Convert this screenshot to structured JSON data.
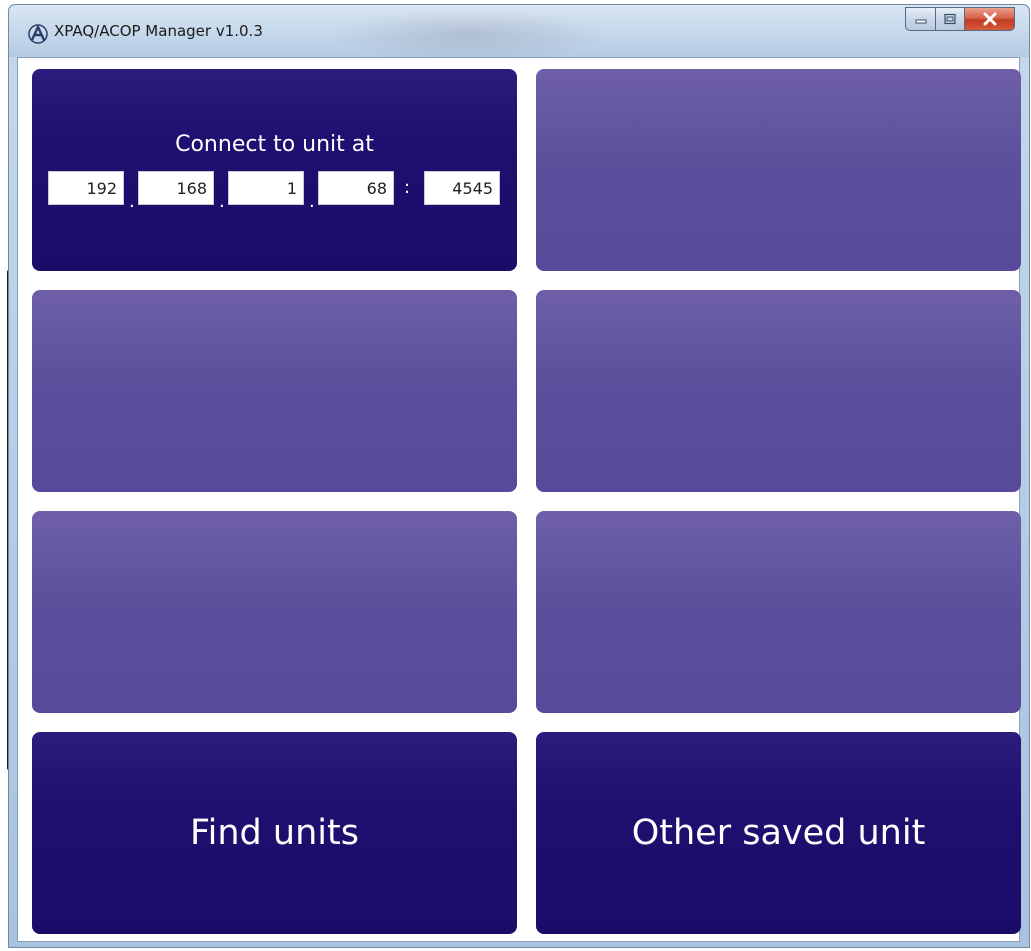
{
  "window": {
    "title": "XPAQ/ACOP Manager v1.0.3",
    "icon": "app-logo-a-icon",
    "controls": {
      "minimize": "minimize-icon",
      "maximize": "maximize-icon",
      "close": "close-icon",
      "close_glyph": "x"
    }
  },
  "connect": {
    "label": "Connect to unit at",
    "ip": [
      "192",
      "168",
      "1",
      "68"
    ],
    "port": "4545",
    "dot": ".",
    "colon": ":"
  },
  "buttons": {
    "find_units": "Find units",
    "other_saved_unit": "Other saved unit"
  },
  "colors": {
    "tile_dark": "#1f0f70",
    "tile_light": "#5d4f9c",
    "close_red": "#c03c22"
  }
}
